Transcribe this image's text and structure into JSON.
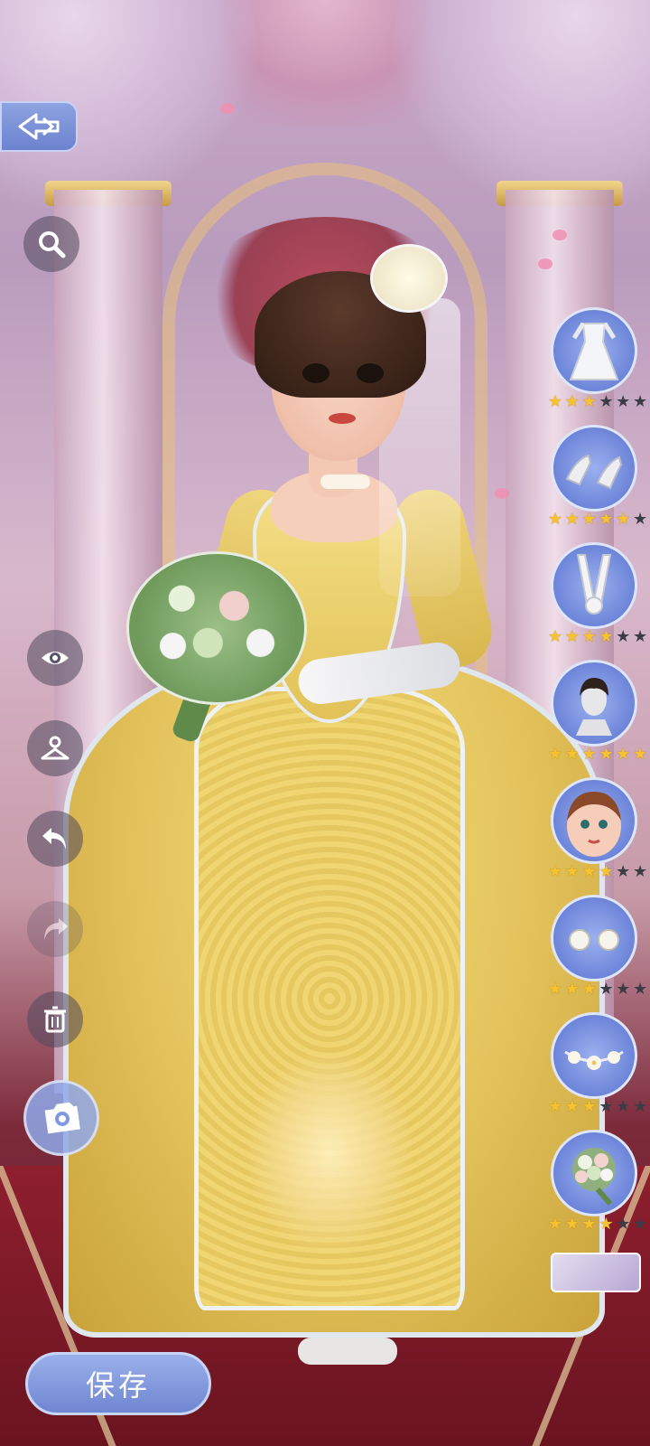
{
  "save_button": {
    "label": "保存"
  },
  "left_toolbar": {
    "back": "back-arrow-icon",
    "tools": [
      {
        "name": "zoom",
        "icon": "magnifier-icon",
        "enabled": true
      },
      {
        "name": "view",
        "icon": "eye-icon",
        "enabled": true
      },
      {
        "name": "wardrobe",
        "icon": "hanger-icon",
        "enabled": true
      },
      {
        "name": "undo",
        "icon": "undo-arrow-icon",
        "enabled": true
      },
      {
        "name": "redo",
        "icon": "redo-arrow-icon",
        "enabled": false
      },
      {
        "name": "delete",
        "icon": "trash-icon",
        "enabled": true
      },
      {
        "name": "photo",
        "icon": "camera-icon",
        "enabled": true
      }
    ]
  },
  "outfit_items": [
    {
      "name": "wedding gown",
      "icon": "gown-icon",
      "stars": 3,
      "max_stars": 6
    },
    {
      "name": "high heels",
      "icon": "shoes-icon",
      "stars": 5,
      "max_stars": 6
    },
    {
      "name": "gloves",
      "icon": "gloves-icon",
      "stars": 4,
      "max_stars": 6
    },
    {
      "name": "hairstyle",
      "icon": "hair-icon",
      "stars": 6,
      "max_stars": 6
    },
    {
      "name": "makeup",
      "icon": "face-icon",
      "stars": 4,
      "max_stars": 6
    },
    {
      "name": "earrings",
      "icon": "pearl-earrings-icon",
      "stars": 3,
      "max_stars": 6
    },
    {
      "name": "necklace",
      "icon": "flower-necklace-icon",
      "stars": 3,
      "max_stars": 6
    },
    {
      "name": "bouquet",
      "icon": "bouquet-icon",
      "stars": 4,
      "max_stars": 6
    }
  ],
  "colors": {
    "accent": "#7b90dc",
    "star_on": "#f6c230",
    "star_off": "#3c3c46",
    "dress": "#e2c15a",
    "carpet": "#8e1f2e"
  }
}
